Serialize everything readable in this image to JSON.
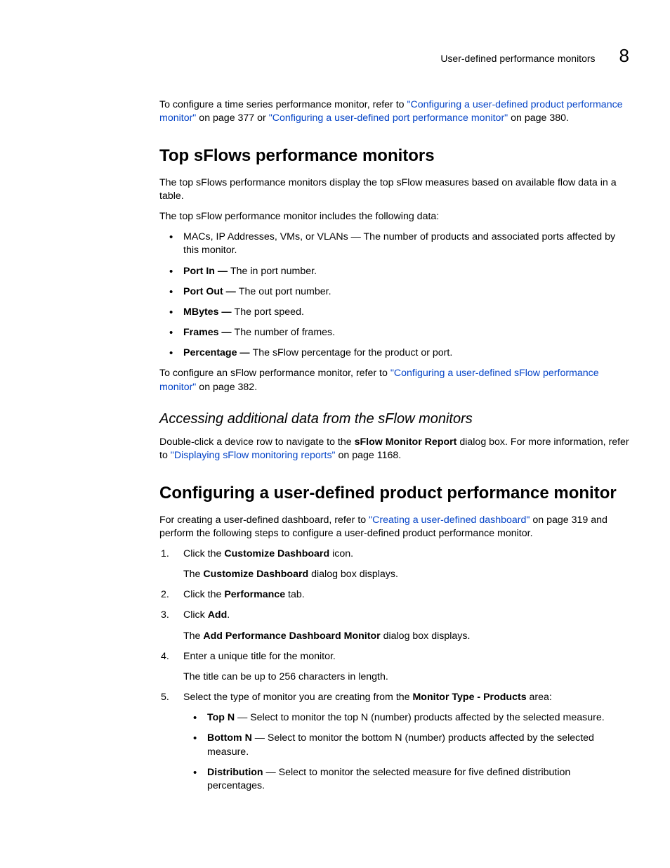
{
  "header": {
    "title": "User-defined performance monitors",
    "chapter_number": "8"
  },
  "intro": {
    "pre": "To configure a time series performance monitor, refer to ",
    "link1": "\"Configuring a user-defined product performance monitor\"",
    "mid1": " on page 377 or ",
    "link2": "\"Configuring a user-defined port performance monitor\"",
    "mid2": " on page 380."
  },
  "section1": {
    "heading": "Top sFlows performance monitors",
    "para1": "The top sFlows performance monitors display the top sFlow measures based on available flow data in a table.",
    "para2": "The top sFlow performance monitor includes the following data:",
    "bullets": [
      {
        "bold": "",
        "text": "MACs, IP Addresses, VMs, or VLANs — The number of products and associated ports affected by this monitor."
      },
      {
        "bold": "Port In — ",
        "text": "The in port number."
      },
      {
        "bold": "Port Out — ",
        "text": "The out port number."
      },
      {
        "bold": "MBytes — ",
        "text": "The port speed."
      },
      {
        "bold": "Frames — ",
        "text": "The number of frames."
      },
      {
        "bold": "Percentage — ",
        "text": "The sFlow percentage for the product or port."
      }
    ],
    "para3_pre": "To configure an sFlow performance monitor, refer to ",
    "para3_link": "\"Configuring a user-defined sFlow performance monitor\"",
    "para3_post": " on page 382.",
    "subheading": "Accessing additional data from the sFlow monitors",
    "subpara_pre": "Double-click a device row to navigate to the ",
    "subpara_bold": "sFlow Monitor Report",
    "subpara_mid": " dialog box. For more information, refer to ",
    "subpara_link": "\"Displaying sFlow monitoring reports\"",
    "subpara_post": " on page 1168."
  },
  "section2": {
    "heading": "Configuring a user-defined product performance monitor",
    "para1_pre": "For creating a user-defined dashboard, refer to ",
    "para1_link": "\"Creating a user-defined dashboard\"",
    "para1_post": " on page 319 and perform the following steps to configure a user-defined product performance monitor.",
    "steps": {
      "s1_pre": "Click the ",
      "s1_bold": "Customize Dashboard",
      "s1_post": " icon.",
      "s1_sub_pre": "The ",
      "s1_sub_bold": "Customize Dashboard",
      "s1_sub_post": " dialog box displays.",
      "s2_pre": "Click the ",
      "s2_bold": "Performance",
      "s2_post": " tab.",
      "s3_pre": "Click ",
      "s3_bold": "Add",
      "s3_post": ".",
      "s3_sub_pre": "The ",
      "s3_sub_bold": "Add Performance Dashboard Monitor",
      "s3_sub_post": " dialog box displays.",
      "s4_main": "Enter a unique title for the monitor.",
      "s4_sub": "The title can be up to 256 characters in length.",
      "s5_pre": "Select the type of monitor you are creating from the ",
      "s5_bold": "Monitor Type - Products",
      "s5_post": " area:",
      "s5_bullets": [
        {
          "bold": "Top N",
          "text": " — Select to monitor the top N (number) products affected by the selected measure."
        },
        {
          "bold": "Bottom N",
          "text": " — Select to monitor the bottom N (number) products affected by the selected measure."
        },
        {
          "bold": "Distribution",
          "text": " — Select to monitor the selected measure for five defined distribution percentages."
        }
      ]
    }
  }
}
